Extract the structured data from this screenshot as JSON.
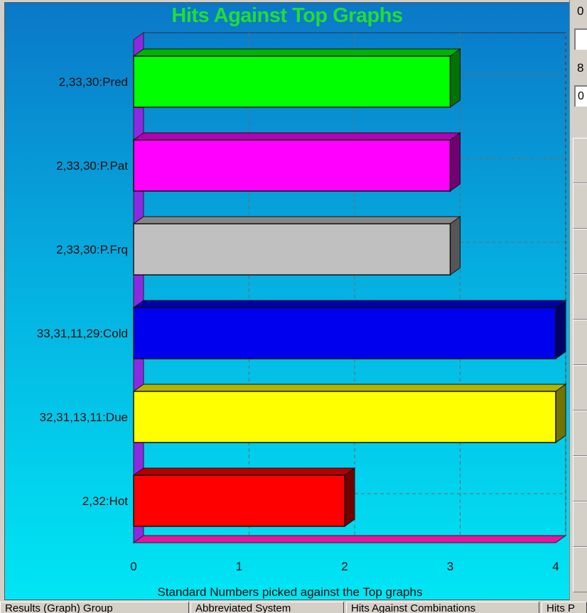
{
  "chart_data": {
    "type": "bar",
    "orientation": "horizontal",
    "title": "Hits Against Top Graphs",
    "xlabel": "Standard Numbers picked against the Top graphs",
    "ylabel": "",
    "xlim": [
      0,
      4
    ],
    "xticks": [
      "0",
      "1",
      "2",
      "3",
      "4"
    ],
    "grid": true,
    "categories": [
      "2,33,30:Pred",
      "2,33,30:P.Pat",
      "2,33,30:P.Frq",
      "33,31,11,29:Cold",
      "32,31,13,11:Due",
      "2,32:Hot"
    ],
    "values": [
      3,
      3,
      3,
      4,
      4,
      2
    ],
    "colors": [
      "#00ff00",
      "#ff00ff",
      "#c0c0c0",
      "#0000ee",
      "#ffff00",
      "#ff0000"
    ]
  },
  "right_strip": {
    "top_value": "0",
    "mid_value": "8",
    "field_value": "0"
  },
  "tabs": [
    {
      "label": "Results (Graph) Group"
    },
    {
      "label": "Abbreviated System"
    },
    {
      "label": "Hits Against Combinations"
    },
    {
      "label": "Hits P"
    }
  ]
}
